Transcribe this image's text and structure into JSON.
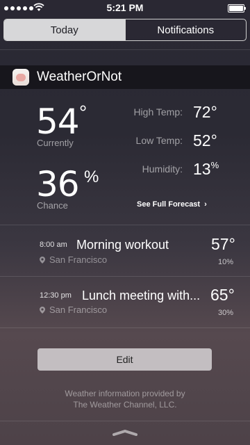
{
  "status_bar": {
    "time": "5:21 PM",
    "signal_dots": 5
  },
  "tabs": [
    {
      "label": "Today",
      "selected": true
    },
    {
      "label": "Notifications",
      "selected": false
    }
  ],
  "widget": {
    "app_name": "WeatherOrNot",
    "current": {
      "temp": "54",
      "temp_unit": "°",
      "temp_label": "Currently",
      "chance": "36",
      "chance_unit": "%",
      "chance_label": "Chance"
    },
    "stats": [
      {
        "label": "High Temp:",
        "value": "72",
        "unit": "°"
      },
      {
        "label": "Low Temp:",
        "value": "52",
        "unit": "°"
      },
      {
        "label": "Humidity:",
        "value": "13",
        "unit": "%"
      }
    ],
    "forecast_link": "See Full Forecast",
    "events": [
      {
        "time": "8:00 am",
        "title": "Morning workout",
        "location": "San Francisco",
        "temp": "57°",
        "chance": "10%"
      },
      {
        "time": "12:30 pm",
        "title": "Lunch meeting with...",
        "location": "San Francisco",
        "temp": "65°",
        "chance": "30%"
      }
    ],
    "edit_label": "Edit",
    "credit_line1": "Weather information provided by",
    "credit_line2": "The Weather Channel, LLC."
  },
  "colors": {
    "segment_active_bg": "#d7d7d9",
    "header_bg": "#111015",
    "edit_bg": "#d7d4d6"
  }
}
